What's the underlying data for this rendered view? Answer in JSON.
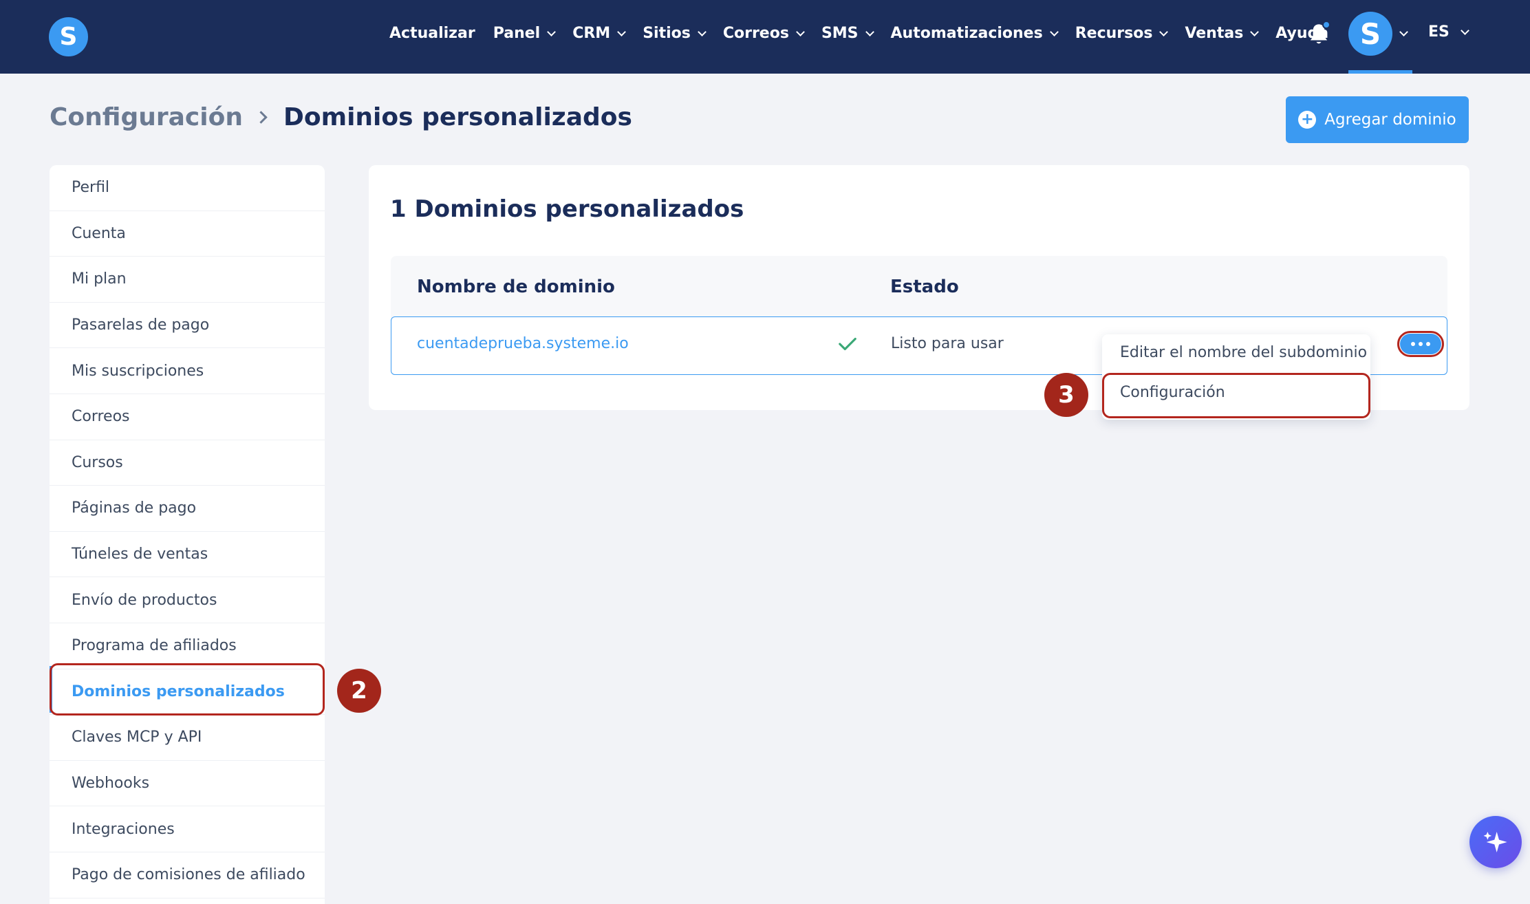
{
  "nav": {
    "items": [
      {
        "label": "Actualizar",
        "dropdown": false
      },
      {
        "label": "Panel",
        "dropdown": true
      },
      {
        "label": "CRM",
        "dropdown": true
      },
      {
        "label": "Sitios",
        "dropdown": true
      },
      {
        "label": "Correos",
        "dropdown": true
      },
      {
        "label": "SMS",
        "dropdown": true
      },
      {
        "label": "Automatizaciones",
        "dropdown": true
      },
      {
        "label": "Recursos",
        "dropdown": true
      },
      {
        "label": "Ventas",
        "dropdown": true
      },
      {
        "label": "Ayuda",
        "dropdown": false
      }
    ],
    "logo_letter": "S",
    "avatar_letter": "S",
    "language": "ES"
  },
  "breadcrumb": {
    "parent": "Configuración",
    "current": "Dominios personalizados"
  },
  "add_button": {
    "label": "Agregar dominio"
  },
  "sidebar": {
    "items": [
      {
        "label": "Perfil"
      },
      {
        "label": "Cuenta"
      },
      {
        "label": "Mi plan"
      },
      {
        "label": "Pasarelas de pago"
      },
      {
        "label": "Mis suscripciones"
      },
      {
        "label": "Correos"
      },
      {
        "label": "Cursos"
      },
      {
        "label": "Páginas de pago"
      },
      {
        "label": "Túneles de ventas"
      },
      {
        "label": "Envío de productos"
      },
      {
        "label": "Programa de afiliados"
      },
      {
        "label": "Dominios personalizados",
        "active": true
      },
      {
        "label": "Claves MCP y API"
      },
      {
        "label": "Webhooks"
      },
      {
        "label": "Integraciones"
      },
      {
        "label": "Pago de comisiones de afiliado"
      }
    ]
  },
  "steps": {
    "sidebar_step": "2",
    "menu_step": "3"
  },
  "card": {
    "title": "1 Dominios personalizados",
    "columns": {
      "domain": "Nombre de dominio",
      "status": "Estado"
    },
    "rows": [
      {
        "domain": "cuentadeprueba.systeme.io",
        "status": "Listo para usar"
      }
    ]
  },
  "dropdown": {
    "items": [
      "Editar el nombre del subdominio",
      "Configuración"
    ]
  },
  "colors": {
    "nav_bg": "#1b2d5a",
    "accent": "#3b9af2",
    "highlight": "#b3261e",
    "success": "#3aa876"
  }
}
